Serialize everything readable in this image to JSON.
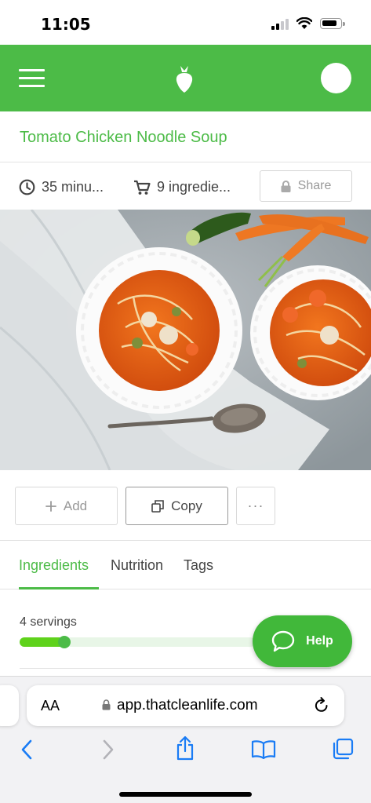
{
  "status_bar": {
    "time": "11:05"
  },
  "header": {
    "menu_icon": "hamburger-menu-icon",
    "logo_icon": "carrot-logo-icon",
    "avatar_icon": "avatar",
    "accent_color": "#4cbb47"
  },
  "recipe": {
    "title": "Tomato Chicken Noodle Soup",
    "time_label": "35 minu...",
    "ingredients_label": "9 ingredie...",
    "share_label": "Share"
  },
  "actions": {
    "add_label": "Add",
    "copy_label": "Copy",
    "more_label": "···"
  },
  "tabs": [
    {
      "label": "Ingredients",
      "active": true
    },
    {
      "label": "Nutrition",
      "active": false
    },
    {
      "label": "Tags",
      "active": false
    }
  ],
  "servings": {
    "label": "4 servings",
    "slider_fraction": 0.19
  },
  "help": {
    "label": "Help"
  },
  "browser": {
    "text_size_label": "AA",
    "url": "app.thatcleanlife.com"
  }
}
